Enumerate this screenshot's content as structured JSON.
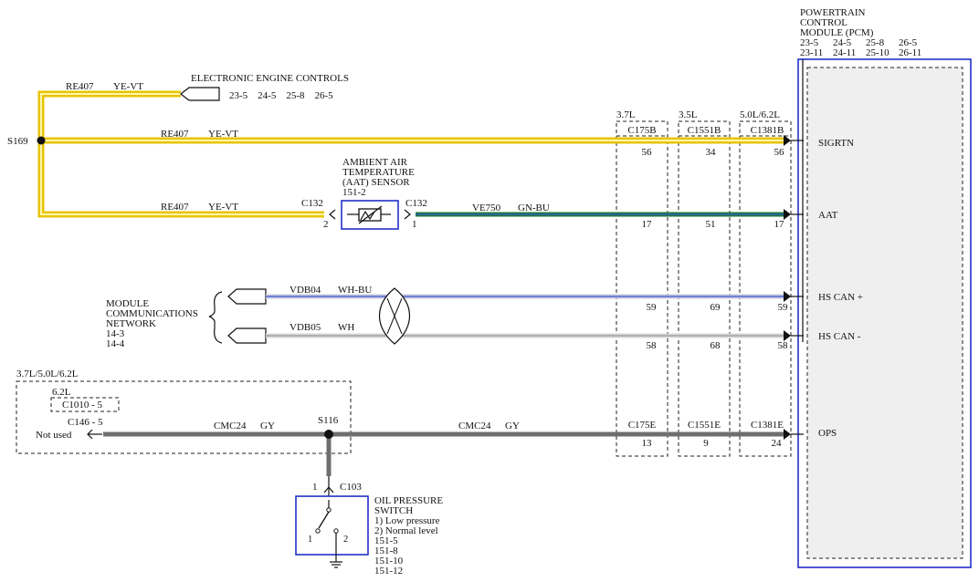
{
  "pcm": {
    "title_lines": [
      "POWERTRAIN",
      "CONTROL",
      "MODULE (PCM)"
    ],
    "ref_row1": [
      "23-5",
      "24-5",
      "25-8",
      "26-5"
    ],
    "ref_row2": [
      "23-11",
      "24-11",
      "25-10",
      "26-11"
    ],
    "pins": {
      "sigrtn": "SIGRTN",
      "aat": "AAT",
      "hs_can_plus": "HS CAN +",
      "hs_can_minus": "HS CAN -",
      "ops": "OPS"
    }
  },
  "engine_variants": {
    "v37": {
      "label": "3.7L",
      "connector_top": "C175B",
      "connector_bottom": "C175E",
      "pins": [
        "56",
        "17",
        "59",
        "58",
        "13"
      ]
    },
    "v35": {
      "label": "3.5L",
      "connector_top": "C1551B",
      "connector_bottom": "C1551E",
      "pins": [
        "34",
        "51",
        "69",
        "68",
        "9"
      ]
    },
    "v50": {
      "label": "5.0L/6.2L",
      "connector_top": "C1381B",
      "connector_bottom": "C1381E",
      "pins": [
        "56",
        "17",
        "59",
        "58",
        "24"
      ]
    }
  },
  "eec": {
    "title": "ELECTRONIC ENGINE CONTROLS",
    "refs": "23-5    24-5    25-8    26-5"
  },
  "wires": {
    "re407_circuit": "RE407",
    "re407_color": "YE-VT",
    "ve750_circuit": "VE750",
    "ve750_color": "GN-BU",
    "vdb04_circuit": "VDB04",
    "vdb04_color": "WH-BU",
    "vdb05_circuit": "VDB05",
    "vdb05_color": "WH",
    "cmc24_circuit": "CMC24",
    "cmc24_color": "GY",
    "yellow_color": "#e8c400",
    "green_color": "#1a7a3a",
    "blue_stripe_color": "#3a58d0",
    "gray_color": "#6e6e6e",
    "module_outline_color": "#2230c8"
  },
  "splices": {
    "s169": "S169",
    "s116": "S116"
  },
  "aat_sensor": {
    "title_lines": [
      "AMBIENT AIR",
      "TEMPERATURE",
      "(AAT) SENSOR",
      "151-2"
    ],
    "connector": "C132",
    "pin_left": "2",
    "pin_right": "1"
  },
  "network": {
    "title_lines": [
      "MODULE",
      "COMMUNICATIONS",
      "NETWORK",
      "14-3",
      "14-4"
    ]
  },
  "ops_box": {
    "variant_label": "3.7L/5.0L/6.2L",
    "sub_variant_label": "6.2L",
    "sub_connector": "C1010 - 5",
    "connector": "C146 - 5",
    "not_used": "Not used"
  },
  "oil_switch": {
    "title_lines": [
      "OIL PRESSURE",
      "SWITCH",
      "1) Low pressure",
      "2) Normal level",
      "151-5",
      "151-8",
      "151-10",
      "151-12"
    ],
    "connector": "C103",
    "pin_top": "1",
    "pin_a": "1",
    "pin_b": "2"
  }
}
